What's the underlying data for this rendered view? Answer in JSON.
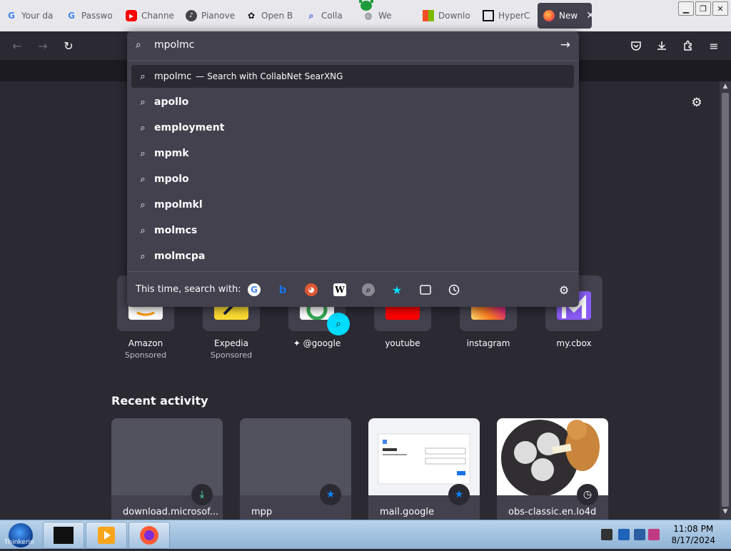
{
  "tabs": [
    {
      "title": "Your da",
      "icon": "google-icon"
    },
    {
      "title": "Passwo",
      "icon": "google-icon"
    },
    {
      "title": "Channe",
      "icon": "youtube-icon"
    },
    {
      "title": "Pianove",
      "icon": "pianoverse-icon"
    },
    {
      "title": "Open B",
      "icon": "openai-icon"
    },
    {
      "title": "Colla",
      "icon": "search-icon"
    },
    {
      "title": "We",
      "icon": "globe-icon"
    },
    {
      "title": "Downlo",
      "icon": "microsoft-icon"
    },
    {
      "title": "HyperC",
      "icon": "museum-icon"
    },
    {
      "title": "New",
      "icon": "firefox-icon",
      "active": true
    }
  ],
  "urlbar": {
    "typed": "mpolmc",
    "first_result": {
      "text": "mpolmc",
      "hint": "— Search with CollabNet SearXNG"
    },
    "suggestions": [
      "apollo",
      "employment",
      "mpmk",
      "mpolo",
      "mpolmkl",
      "molmcs",
      "molmcpa"
    ],
    "oneoff_label": "This time, search with:"
  },
  "shortcuts": [
    {
      "label": "Amazon",
      "sub": "Sponsored"
    },
    {
      "label": "Expedia",
      "sub": "Sponsored"
    },
    {
      "label": "@google",
      "sub": ""
    },
    {
      "label": "youtube",
      "sub": ""
    },
    {
      "label": "instagram",
      "sub": ""
    },
    {
      "label": "my.cbox",
      "sub": ""
    }
  ],
  "recent_title": "Recent activity",
  "recent": [
    {
      "label": "download.microsof...",
      "badge": "download-icon"
    },
    {
      "label": "mpp",
      "badge": "star-icon"
    },
    {
      "label": "mail.google",
      "badge": "star-icon"
    },
    {
      "label": "obs-classic.en.lo4d",
      "badge": "clock-icon"
    }
  ],
  "taskbar": {
    "start_text": "Thinkerin",
    "time": "11:08 PM",
    "date": "8/17/2024"
  },
  "colors": {
    "accent": "#00ddff",
    "panel": "#42414d",
    "bg": "#2b2a33"
  }
}
